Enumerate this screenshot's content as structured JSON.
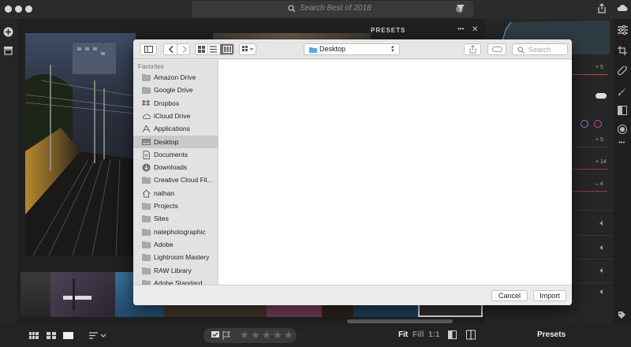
{
  "app": {
    "search": {
      "placeholder": "Search Best of 2018"
    },
    "presets_panel": {
      "title": "PRESETS",
      "more": "•••",
      "close": "✕"
    },
    "right_panel": {
      "values": [
        "+ 5",
        "+ 5",
        "+ 14",
        "– 4"
      ]
    },
    "bottom_bar": {
      "view_fit": "Fit",
      "view_fill": "Fill",
      "view_1to1": "1:1",
      "presets_label": "Presets",
      "stars": [
        "★",
        "★",
        "★",
        "★",
        "★"
      ]
    }
  },
  "dialog": {
    "location": "Desktop",
    "search_placeholder": "Search",
    "sidebar": {
      "heading": "Favorites",
      "items": [
        {
          "label": "Amazon Drive",
          "icon": "folder-icon"
        },
        {
          "label": "Google Drive",
          "icon": "folder-icon"
        },
        {
          "label": "Dropbox",
          "icon": "dropbox-icon"
        },
        {
          "label": "iCloud Drive",
          "icon": "cloud-icon"
        },
        {
          "label": "Applications",
          "icon": "applications-icon"
        },
        {
          "label": "Desktop",
          "icon": "desktop-icon",
          "selected": true
        },
        {
          "label": "Documents",
          "icon": "documents-icon"
        },
        {
          "label": "Downloads",
          "icon": "downloads-icon"
        },
        {
          "label": "Creative Cloud Fil...",
          "icon": "folder-icon"
        },
        {
          "label": "nathan",
          "icon": "home-icon"
        },
        {
          "label": "Projects",
          "icon": "folder-icon"
        },
        {
          "label": "Sites",
          "icon": "folder-icon"
        },
        {
          "label": "natephotographic",
          "icon": "folder-icon"
        },
        {
          "label": "Adobe",
          "icon": "folder-icon"
        },
        {
          "label": "Lightroom Mastery",
          "icon": "folder-icon"
        },
        {
          "label": "RAW Library",
          "icon": "folder-icon"
        },
        {
          "label": "Adobe Standard",
          "icon": "folder-icon"
        }
      ]
    },
    "buttons": {
      "cancel": "Cancel",
      "import": "Import"
    }
  },
  "colors": {
    "accent_purple": "#9b6fd6",
    "selection_gray": "#c9c9c9",
    "folder_blue": "#5aa6e8"
  }
}
